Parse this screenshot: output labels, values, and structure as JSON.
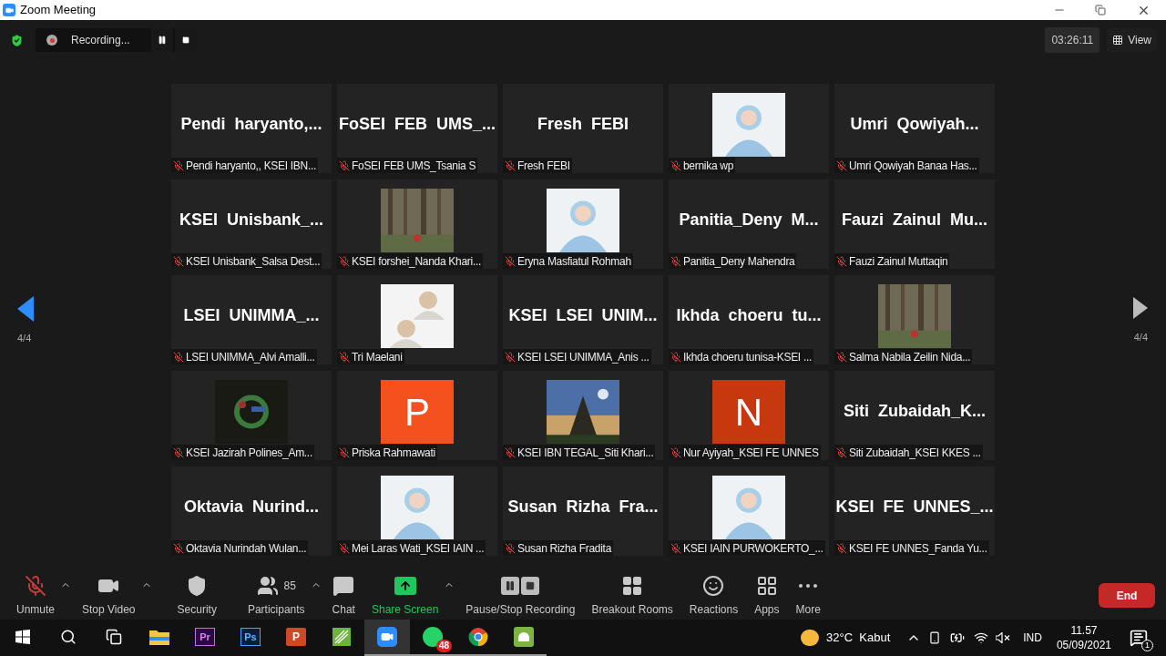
{
  "window": {
    "title": "Zoom Meeting"
  },
  "topbar": {
    "recording": "Recording...",
    "timer": "03:26:11",
    "view": "View"
  },
  "pager": {
    "left": "4/4",
    "right": "4/4"
  },
  "tiles": [
    {
      "kind": "name",
      "big_name": "Pendi  haryanto,...",
      "name": "Pendi haryanto,, KSEI IBN...",
      "muted": true
    },
    {
      "kind": "name",
      "big_name": "FoSEI  FEB  UMS_...",
      "name": "FoSEI FEB UMS_Tsania S",
      "muted": true
    },
    {
      "kind": "name",
      "big_name": "Fresh  FEBI",
      "name": "Fresh FEBI",
      "muted": true
    },
    {
      "kind": "picture",
      "name": "bernika wp",
      "muted": true
    },
    {
      "kind": "name",
      "big_name": "Umri  Qowiyah...",
      "name": "Umri Qowiyah Banaa Has...",
      "muted": true
    },
    {
      "kind": "name",
      "big_name": "KSEI  Unisbank_...",
      "name": "KSEI Unisbank_Salsa Dest...",
      "muted": true
    },
    {
      "kind": "picture",
      "name": "KSEI forshei_Nanda Khari...",
      "muted": true
    },
    {
      "kind": "picture",
      "name": "Eryna Masfiatul Rohmah",
      "muted": true
    },
    {
      "kind": "name",
      "big_name": "Panitia_Deny  M...",
      "name": "Panitia_Deny Mahendra",
      "muted": true
    },
    {
      "kind": "name",
      "big_name": "Fauzi  Zainul  Mu...",
      "name": "Fauzi Zainul Muttaqin",
      "muted": true
    },
    {
      "kind": "name",
      "big_name": "LSEI  UNIMMA_...",
      "name": "LSEI UNIMMA_Alvi Amalli...",
      "muted": true
    },
    {
      "kind": "picture",
      "name": "Tri Maelani",
      "muted": true
    },
    {
      "kind": "name",
      "big_name": "KSEI  LSEI  UNIM...",
      "name": "KSEI LSEI UNIMMA_Anis ...",
      "muted": true
    },
    {
      "kind": "name",
      "big_name": "Ikhda  choeru  tu...",
      "name": "Ikhda choeru tunisa-KSEI ...",
      "muted": true
    },
    {
      "kind": "picture",
      "name": "Salma Nabila Zeilin Nida...",
      "muted": true
    },
    {
      "kind": "picture",
      "name": "KSEI Jazirah Polines_Am...",
      "muted": true
    },
    {
      "kind": "letter",
      "letter": "P",
      "color": "#f4511e",
      "name": "Priska Rahmawati",
      "muted": true
    },
    {
      "kind": "picture",
      "name": "KSEI IBN TEGAL_Siti Khari...",
      "muted": true
    },
    {
      "kind": "letter",
      "letter": "N",
      "color": "#c8380f",
      "name": "Nur Ayiyah_KSEI FE UNNES",
      "muted": true
    },
    {
      "kind": "name",
      "big_name": "Siti  Zubaidah_K...",
      "name": "Siti Zubaidah_KSEI KKES ...",
      "muted": true
    },
    {
      "kind": "name",
      "big_name": "Oktavia  Nurind...",
      "name": "Oktavia Nurindah Wulan...",
      "muted": true
    },
    {
      "kind": "picture",
      "name": "Mei Laras Wati_KSEI IAIN ...",
      "muted": true
    },
    {
      "kind": "name",
      "big_name": "Susan  Rizha  Fra...",
      "name": "Susan Rizha Fradita",
      "muted": true
    },
    {
      "kind": "picture",
      "name": "KSEI IAIN PURWOKERTO_...",
      "muted": true
    },
    {
      "kind": "name",
      "big_name": "KSEI  FE  UNNES_...",
      "name": "KSEI FE UNNES_Fanda Yu...",
      "muted": true
    }
  ],
  "toolbar": [
    {
      "kind": "mic_off",
      "label": "Unmute",
      "has_menu": true
    },
    {
      "kind": "video",
      "label": "Stop Video",
      "has_menu": true
    },
    {
      "kind": "security",
      "label": "Security",
      "has_menu": false
    },
    {
      "kind": "participants",
      "label": "Participants",
      "count": "85",
      "has_menu": true
    },
    {
      "kind": "chat",
      "label": "Chat",
      "has_menu": false
    },
    {
      "kind": "share",
      "label": "Share Screen",
      "has_menu": true
    },
    {
      "kind": "recording",
      "label": "Pause/Stop Recording",
      "has_menu": false
    },
    {
      "kind": "breakout",
      "label": "Breakout Rooms",
      "has_menu": false
    },
    {
      "kind": "reactions",
      "label": "Reactions",
      "has_menu": false
    },
    {
      "kind": "apps",
      "label": "Apps",
      "has_menu": false
    },
    {
      "kind": "more",
      "label": "More",
      "has_menu": false
    }
  ],
  "end_button": "End",
  "taskbar": {
    "apps": [
      {
        "kind": "start",
        "selected": false,
        "running": false
      },
      {
        "kind": "search",
        "selected": false,
        "running": false
      },
      {
        "kind": "taskview",
        "selected": false,
        "running": false
      },
      {
        "kind": "explorer",
        "selected": false,
        "running": false
      },
      {
        "kind": "premiere",
        "label": "Pr",
        "selected": false,
        "running": false
      },
      {
        "kind": "photoshop",
        "label": "Ps",
        "selected": false,
        "running": false
      },
      {
        "kind": "powerpoint",
        "label": "P",
        "selected": false,
        "running": false
      },
      {
        "kind": "corel",
        "selected": false,
        "running": false
      },
      {
        "kind": "zoom",
        "selected": true,
        "running": true
      },
      {
        "kind": "whatsapp",
        "badge": "48",
        "selected": false,
        "running": true
      },
      {
        "kind": "chrome",
        "selected": false,
        "running": true
      },
      {
        "kind": "android",
        "selected": false,
        "running": true
      }
    ],
    "weather": "32°C  Kabut",
    "language": "IND",
    "time": "11.57",
    "date": "05/09/2021",
    "notifications": "1"
  }
}
